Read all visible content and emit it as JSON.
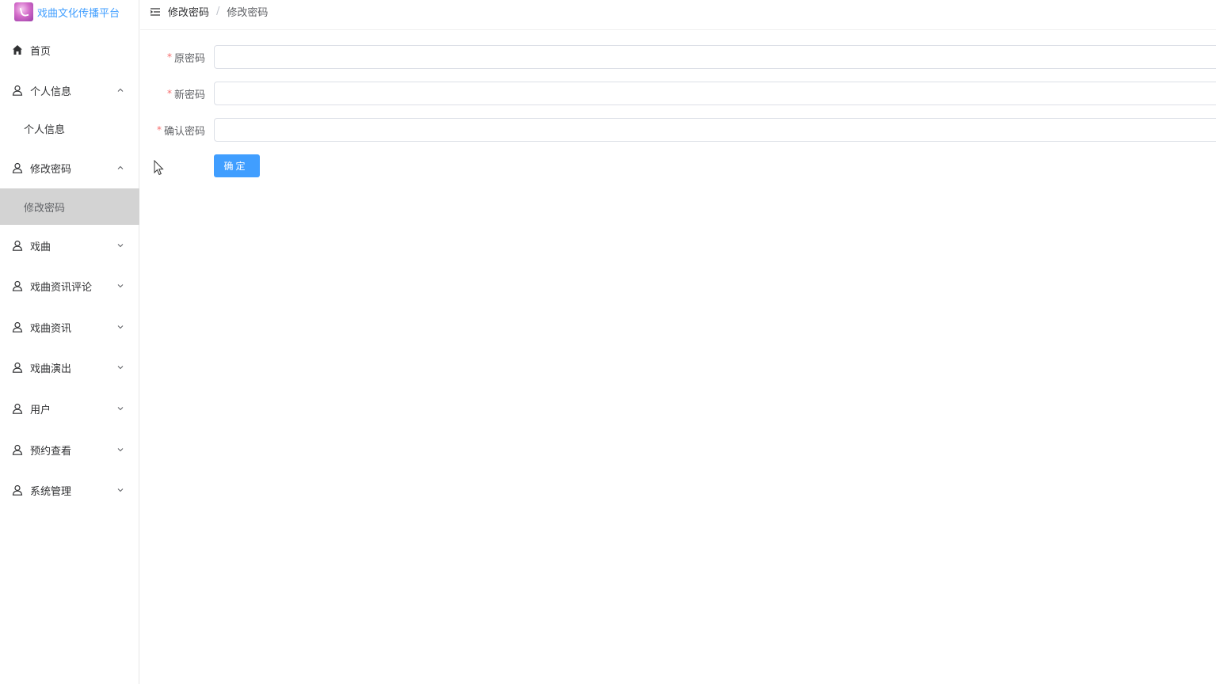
{
  "brand": {
    "name": "戏曲文化传播平台",
    "accent_color": "#409eff",
    "logo_icon": "music-note-logo"
  },
  "header": {
    "menu_icon": "hamburger-icon",
    "breadcrumb": [
      "修改密码",
      "修改密码"
    ],
    "separator": "/"
  },
  "sidebar": {
    "items": [
      {
        "label": "首页",
        "icon": "home-icon",
        "expandable": false
      },
      {
        "label": "个人信息",
        "icon": "user-icon",
        "expanded": true,
        "children": [
          "个人信息"
        ]
      },
      {
        "label": "修改密码",
        "icon": "user-icon",
        "expanded": true,
        "children": [
          "修改密码"
        ],
        "active_child": "修改密码"
      },
      {
        "label": "戏曲",
        "icon": "user-icon",
        "expanded": false
      },
      {
        "label": "戏曲资讯评论",
        "icon": "user-icon",
        "expanded": false
      },
      {
        "label": "戏曲资讯",
        "icon": "user-icon",
        "expanded": false
      },
      {
        "label": "戏曲演出",
        "icon": "user-icon",
        "expanded": false
      },
      {
        "label": "用户",
        "icon": "user-icon",
        "expanded": false
      },
      {
        "label": "预约查看",
        "icon": "user-icon",
        "expanded": false
      },
      {
        "label": "系统管理",
        "icon": "user-icon",
        "expanded": false
      }
    ]
  },
  "form": {
    "required_mark": "*",
    "fields": [
      {
        "label": "原密码",
        "value": "",
        "placeholder": ""
      },
      {
        "label": "新密码",
        "value": "",
        "placeholder": ""
      },
      {
        "label": "确认密码",
        "value": "",
        "placeholder": ""
      }
    ],
    "submit_label": "确定"
  }
}
